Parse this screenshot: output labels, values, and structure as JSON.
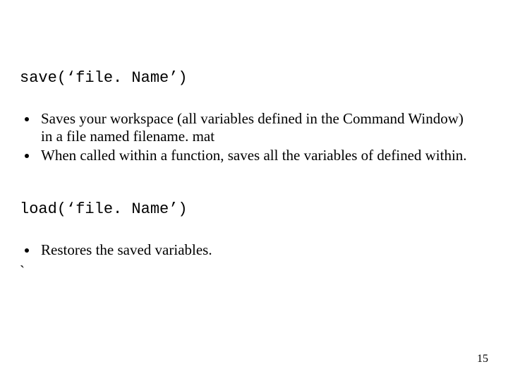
{
  "code1": "save(‘file. Name’)",
  "bullets1": {
    "item1": "Saves your workspace (all variables defined in the Command Window) in a file named filename. mat",
    "item2": "When called within a function, saves all the variables of defined within."
  },
  "code2": "load(‘file. Name’)",
  "bullets2": {
    "item1": "Restores the saved variables."
  },
  "stray_backtick": "`",
  "page_number": "15"
}
